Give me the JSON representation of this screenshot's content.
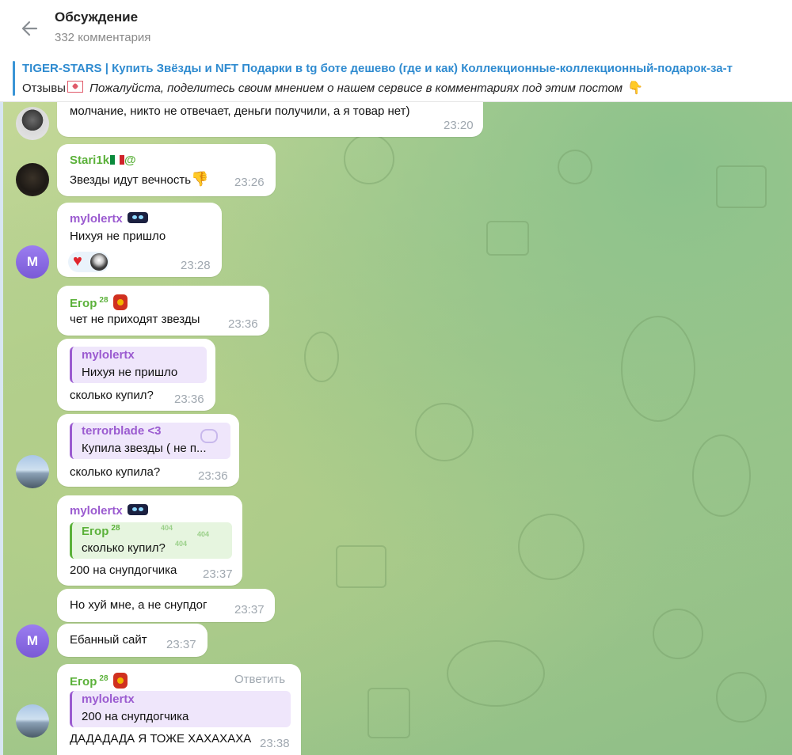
{
  "header": {
    "title": "Обсуждение",
    "subtitle": "332 комментария"
  },
  "pinned": {
    "title": "TIGER-STARS | Купить Звёзды и NFT Подарки в tg боте дешево (где и как) Коллекционные-коллекционный-подарок-за-т",
    "prefix": "Отзывы",
    "text": "Пожалуйста, поделитесь своим мнением о нашем сервисе в комментариях под этим  постом"
  },
  "messages": [
    {
      "text": "молчание, никто не отвечает, деньги получили, а я товар нет)",
      "time": "23:20"
    },
    {
      "name": "Stari1k",
      "name_suffix": "@",
      "text": "Звезды идут вечность",
      "time": "23:26"
    },
    {
      "name": "mylolertx",
      "text": "Нихуя не пришло",
      "time": "23:28"
    },
    {
      "name": "Егор",
      "sup": "28",
      "text": "чет не приходят звезды",
      "time": "23:36"
    },
    {
      "quote_name": "mylolertx",
      "quote_text": "Нихуя не пришло",
      "text": "сколько купил?",
      "time": "23:36"
    },
    {
      "quote_name": "terrorblade <3",
      "quote_text": "Купила звезды ( не п...",
      "text": "сколько купила?",
      "time": "23:36"
    },
    {
      "name": "mylolertx",
      "quote_name": "Егор",
      "quote_sup": "28",
      "quote_text": "сколько купил?",
      "text": "200 на снупдогчика",
      "time": "23:37"
    },
    {
      "text": "Но хуй мне, а не снупдог",
      "time": "23:37"
    },
    {
      "text": "Ебанный сайт",
      "time": "23:37"
    },
    {
      "name": "Егор",
      "sup": "28",
      "reply_label": "Ответить",
      "quote_name": "mylolertx",
      "quote_text": "200 на снупдогчика",
      "text": "ДАДАДАДА Я ТОЖЕ ХАХАХАХА",
      "time": "23:38"
    }
  ],
  "avatars": {
    "m_letter": "M"
  },
  "deco": {
    "label_404": "404"
  },
  "colors": {
    "link": "#2f8bd0",
    "green_name": "#5bb13a",
    "purple_name": "#9b5bd0",
    "time": "#a0a8b0"
  }
}
